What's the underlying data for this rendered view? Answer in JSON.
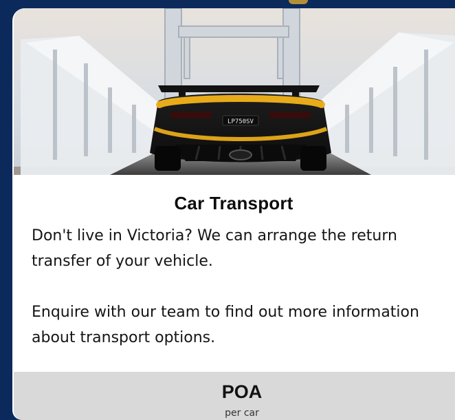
{
  "card": {
    "title": "Car Transport",
    "description_paragraphs": [
      "Don't live in Victoria? We can arrange the return",
      "transfer of your vehicle.",
      "Enquire with our team to find out more information",
      "about transport options."
    ],
    "price": "POA",
    "price_unit": "per car"
  },
  "hero": {
    "plate_text": "LP750SV"
  },
  "colors": {
    "page_bg": "#0b2a5b",
    "card_bg": "#ffffff",
    "price_bar_bg": "#d9d9d9",
    "accent_gold": "#c69a33",
    "car_yellow": "#f3b31a"
  }
}
